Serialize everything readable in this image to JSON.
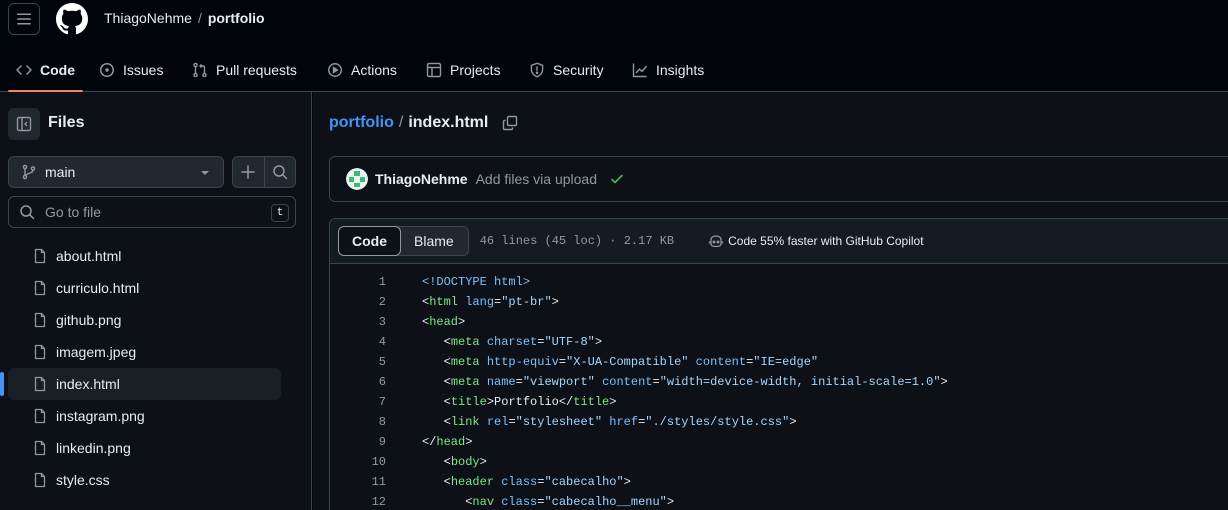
{
  "header": {
    "owner": "ThiagoNehme",
    "separator": "/",
    "repo": "portfolio"
  },
  "tabs": [
    {
      "label": "Code",
      "icon": "code-icon",
      "active": true
    },
    {
      "label": "Issues",
      "icon": "issue-opened-icon"
    },
    {
      "label": "Pull requests",
      "icon": "git-pull-request-icon"
    },
    {
      "label": "Actions",
      "icon": "play-icon"
    },
    {
      "label": "Projects",
      "icon": "table-icon"
    },
    {
      "label": "Security",
      "icon": "shield-icon"
    },
    {
      "label": "Insights",
      "icon": "graph-icon"
    }
  ],
  "sidebar": {
    "title": "Files",
    "branch": "main",
    "search_placeholder": "Go to file",
    "search_shortcut": "t",
    "files": [
      {
        "name": "about.html"
      },
      {
        "name": "curriculo.html"
      },
      {
        "name": "github.png"
      },
      {
        "name": "imagem.jpeg"
      },
      {
        "name": "index.html",
        "selected": true
      },
      {
        "name": "instagram.png"
      },
      {
        "name": "linkedin.png"
      },
      {
        "name": "style.css"
      }
    ]
  },
  "breadcrumb": {
    "repo_link": "portfolio",
    "separator": "/",
    "file": "index.html"
  },
  "commit": {
    "author": "ThiagoNehme",
    "message": "Add files via upload",
    "status_color": "#3fb950"
  },
  "code_view": {
    "code_tab": "Code",
    "blame_tab": "Blame",
    "meta": "46 lines (45 loc) · 2.17 KB",
    "copilot_text": "Code 55% faster with GitHub Copilot"
  },
  "colors": {
    "accent_link": "#4493f8",
    "tab_underline": "#f78166",
    "tag": "#7ee787",
    "attr": "#79c0ff",
    "string": "#a5d6ff"
  },
  "code_lines": [
    {
      "n": "1",
      "tokens": [
        [
          "doct",
          "<!DOCTYPE html>"
        ]
      ]
    },
    {
      "n": "2",
      "tokens": [
        [
          "punc",
          "<"
        ],
        [
          "tag",
          "html"
        ],
        [
          "punc",
          " "
        ],
        [
          "attr",
          "lang"
        ],
        [
          "punc",
          "="
        ],
        [
          "str",
          "\"pt-br\""
        ],
        [
          "punc",
          ">"
        ]
      ]
    },
    {
      "n": "3",
      "tokens": [
        [
          "punc",
          "<"
        ],
        [
          "tag",
          "head"
        ],
        [
          "punc",
          ">"
        ]
      ]
    },
    {
      "n": "4",
      "tokens": [
        [
          "punc",
          "   <"
        ],
        [
          "tag",
          "meta"
        ],
        [
          "punc",
          " "
        ],
        [
          "attr",
          "charset"
        ],
        [
          "punc",
          "="
        ],
        [
          "str",
          "\"UTF-8\""
        ],
        [
          "punc",
          ">"
        ]
      ]
    },
    {
      "n": "5",
      "tokens": [
        [
          "punc",
          "   <"
        ],
        [
          "tag",
          "meta"
        ],
        [
          "punc",
          " "
        ],
        [
          "attr",
          "http-equiv"
        ],
        [
          "punc",
          "="
        ],
        [
          "str",
          "\"X-UA-Compatible\""
        ],
        [
          "punc",
          " "
        ],
        [
          "attr",
          "content"
        ],
        [
          "punc",
          "="
        ],
        [
          "str",
          "\"IE=edge\""
        ]
      ]
    },
    {
      "n": "6",
      "tokens": [
        [
          "punc",
          "   <"
        ],
        [
          "tag",
          "meta"
        ],
        [
          "punc",
          " "
        ],
        [
          "attr",
          "name"
        ],
        [
          "punc",
          "="
        ],
        [
          "str",
          "\"viewport\""
        ],
        [
          "punc",
          " "
        ],
        [
          "attr",
          "content"
        ],
        [
          "punc",
          "="
        ],
        [
          "str",
          "\"width=device-width, initial-scale=1.0\""
        ],
        [
          "punc",
          ">"
        ]
      ]
    },
    {
      "n": "7",
      "tokens": [
        [
          "punc",
          "   <"
        ],
        [
          "tag",
          "title"
        ],
        [
          "punc",
          ">Portfolio</"
        ],
        [
          "tag",
          "title"
        ],
        [
          "punc",
          ">"
        ]
      ]
    },
    {
      "n": "8",
      "tokens": [
        [
          "punc",
          "   <"
        ],
        [
          "tag",
          "link"
        ],
        [
          "punc",
          " "
        ],
        [
          "attr",
          "rel"
        ],
        [
          "punc",
          "="
        ],
        [
          "str",
          "\"stylesheet\""
        ],
        [
          "punc",
          " "
        ],
        [
          "attr",
          "href"
        ],
        [
          "punc",
          "="
        ],
        [
          "str",
          "\"./styles/style.css\""
        ],
        [
          "punc",
          ">"
        ]
      ]
    },
    {
      "n": "9",
      "tokens": [
        [
          "punc",
          "</"
        ],
        [
          "tag",
          "head"
        ],
        [
          "punc",
          ">"
        ]
      ]
    },
    {
      "n": "10",
      "tokens": [
        [
          "punc",
          "   <"
        ],
        [
          "tag",
          "body"
        ],
        [
          "punc",
          ">"
        ]
      ]
    },
    {
      "n": "11",
      "tokens": [
        [
          "punc",
          "   <"
        ],
        [
          "tag",
          "header"
        ],
        [
          "punc",
          " "
        ],
        [
          "attr",
          "class"
        ],
        [
          "punc",
          "="
        ],
        [
          "str",
          "\"cabecalho\""
        ],
        [
          "punc",
          ">"
        ]
      ]
    },
    {
      "n": "12",
      "tokens": [
        [
          "punc",
          "      <"
        ],
        [
          "tag",
          "nav"
        ],
        [
          "punc",
          " "
        ],
        [
          "attr",
          "class"
        ],
        [
          "punc",
          "="
        ],
        [
          "str",
          "\"cabecalho__menu\""
        ],
        [
          "punc",
          ">"
        ]
      ]
    }
  ]
}
